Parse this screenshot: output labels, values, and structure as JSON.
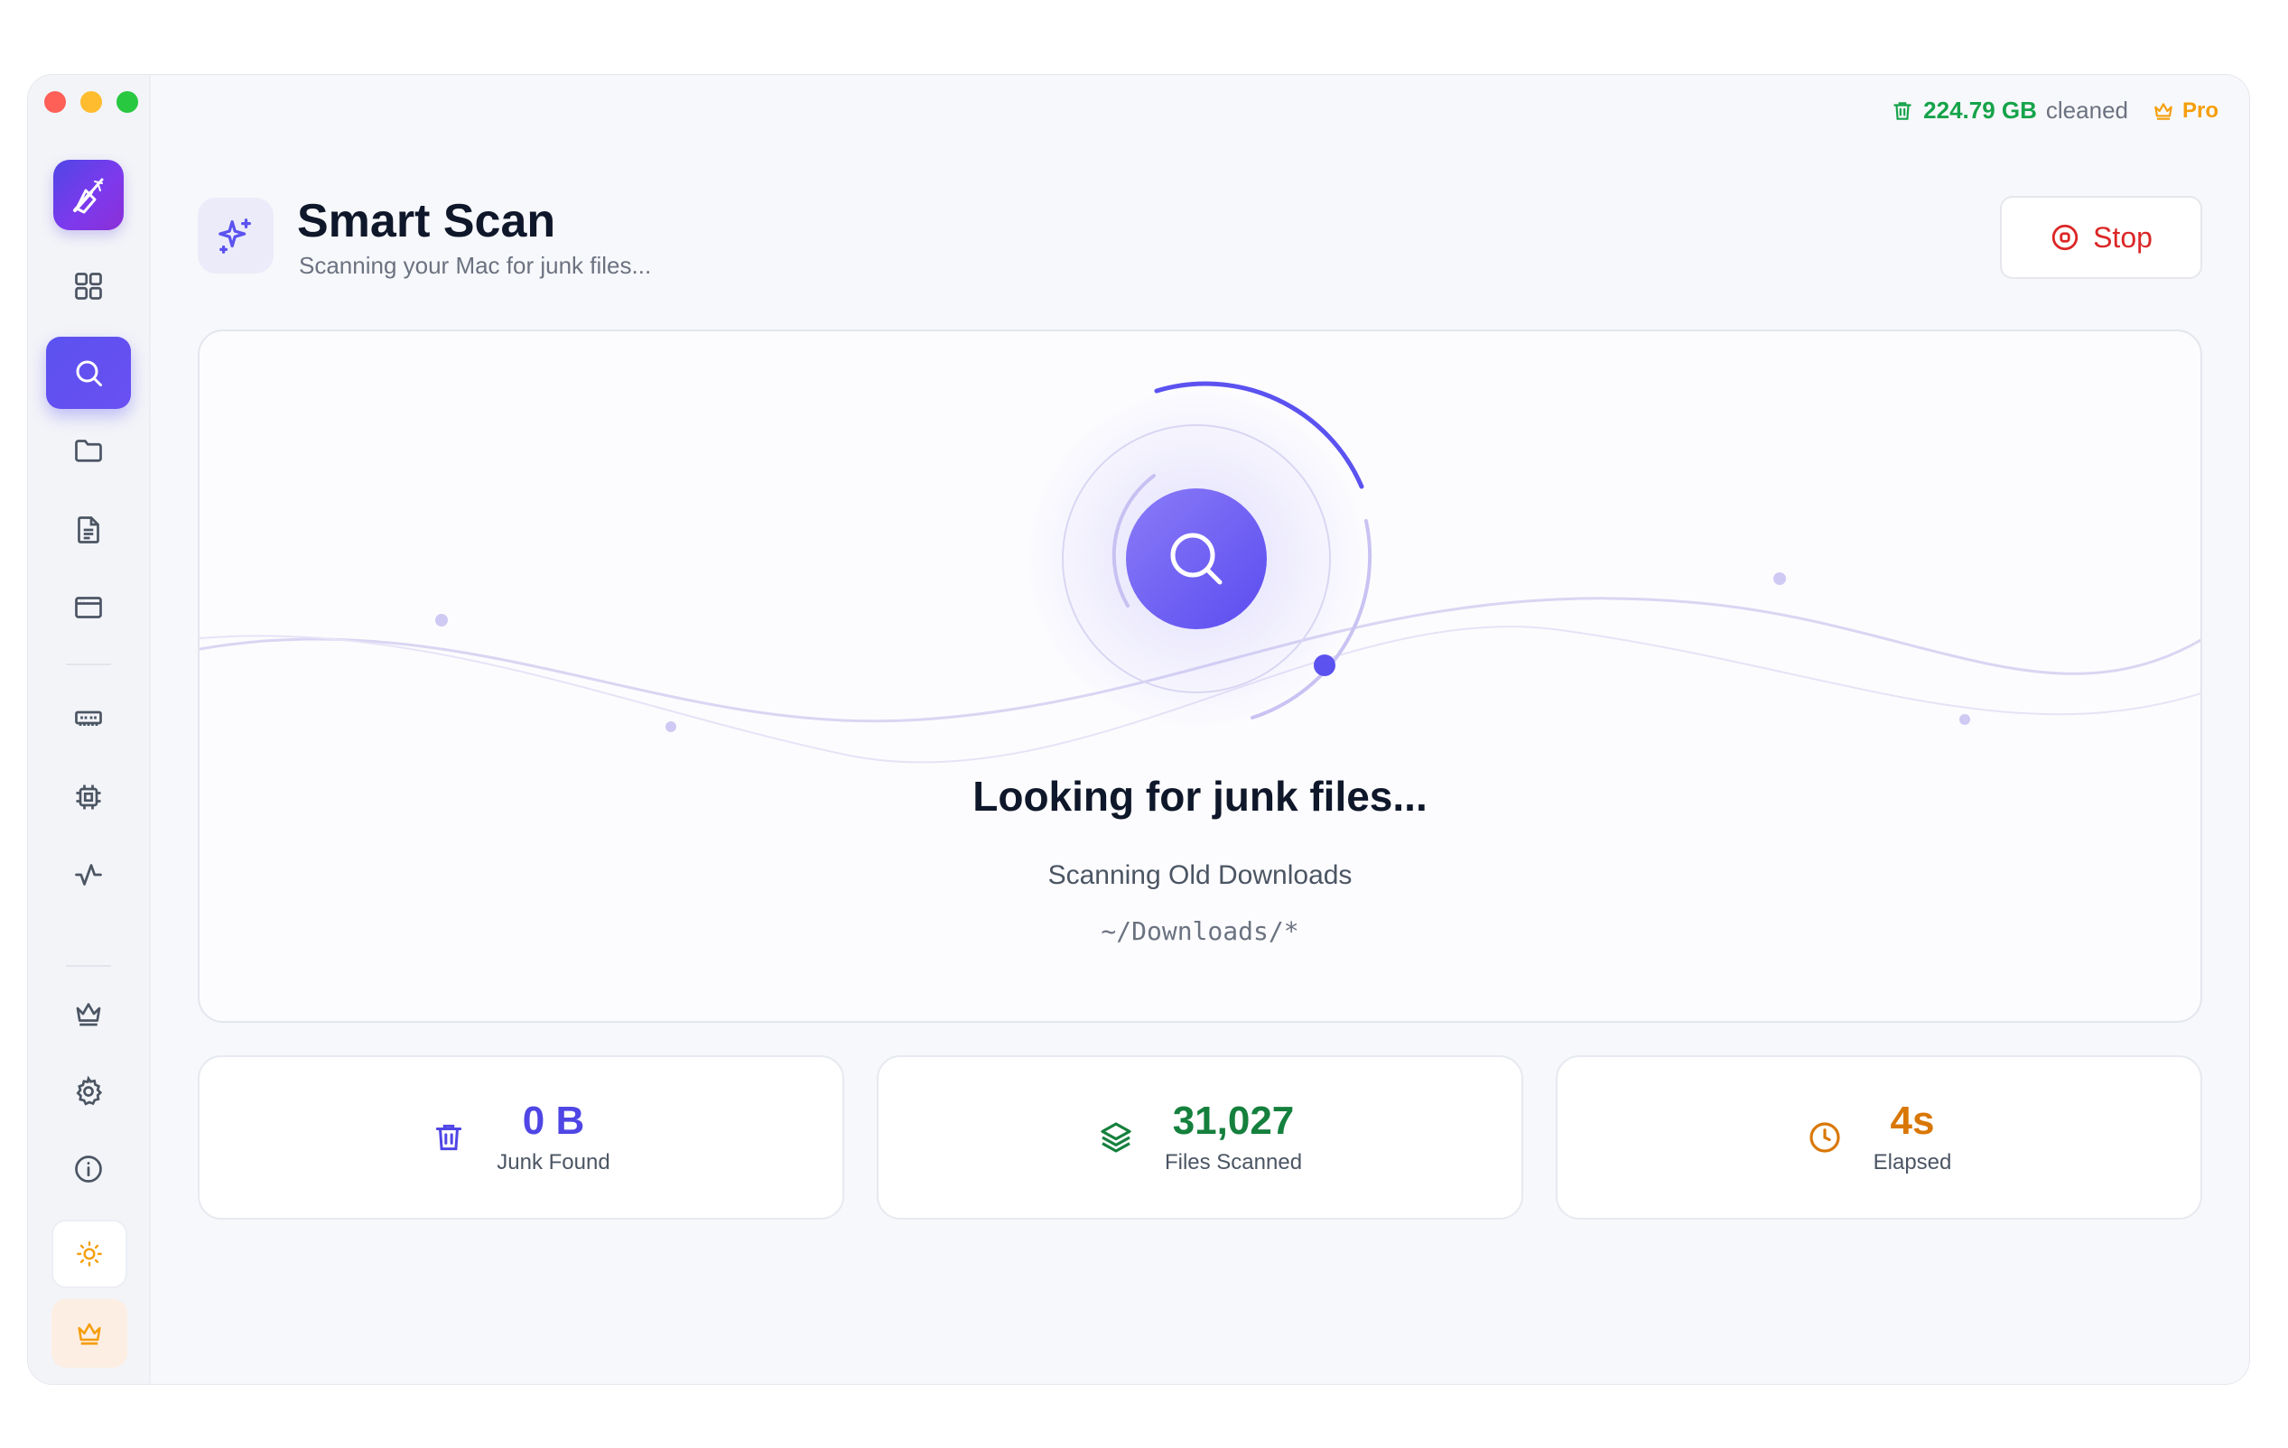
{
  "topbar": {
    "cleaned_value": "224.79 GB",
    "cleaned_suffix": "cleaned",
    "pro_label": "Pro"
  },
  "header": {
    "title": "Smart Scan",
    "subtitle": "Scanning your Mac for junk files..."
  },
  "actions": {
    "stop_label": "Stop"
  },
  "scan": {
    "title": "Looking for junk files...",
    "step": "Scanning Old Downloads",
    "path": "~/Downloads/*"
  },
  "stats": [
    {
      "value": "0 B",
      "label": "Junk Found",
      "color": "#4f46e5"
    },
    {
      "value": "31,027",
      "label": "Files Scanned",
      "color": "#15803d"
    },
    {
      "value": "4s",
      "label": "Elapsed",
      "color": "#d97706"
    }
  ],
  "colors": {
    "accent": "#5b52f0",
    "danger": "#dc2626",
    "success": "#16a34a",
    "warning": "#f59e0b"
  },
  "sidebar": {
    "items": [
      {
        "icon": "grid-icon"
      },
      {
        "icon": "search-icon",
        "active": true
      },
      {
        "icon": "folder-icon"
      },
      {
        "icon": "document-icon"
      },
      {
        "icon": "browser-window-icon"
      },
      {
        "icon": "memory-icon"
      },
      {
        "icon": "cpu-icon"
      },
      {
        "icon": "activity-icon"
      },
      {
        "icon": "crown-icon"
      },
      {
        "icon": "gear-icon"
      },
      {
        "icon": "info-icon"
      }
    ]
  }
}
